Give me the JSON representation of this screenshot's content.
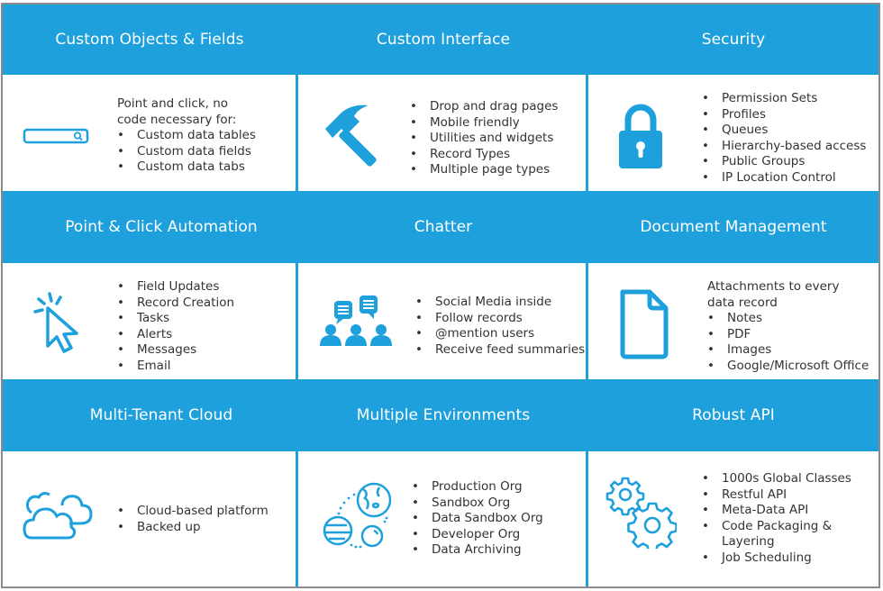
{
  "accent_color": "#1ea0dc",
  "rows": [
    {
      "cells": [
        {
          "title": "Custom Objects & Fields",
          "icon": "search-bar-icon",
          "intro": [
            "Point and click, no",
            "code necessary for:"
          ],
          "items": [
            "Custom data tables",
            "Custom data fields",
            "Custom data tabs"
          ]
        },
        {
          "title": "Custom Interface",
          "icon": "hammer-icon",
          "intro": [],
          "items": [
            "Drop and drag pages",
            "Mobile friendly",
            "Utilities and widgets",
            "Record Types",
            "Multiple page types"
          ]
        },
        {
          "title": "Security",
          "icon": "lock-icon",
          "intro": [],
          "items": [
            "Permission Sets",
            "Profiles",
            "Queues",
            "Hierarchy-based access",
            "Public Groups",
            "IP Location Control"
          ]
        }
      ]
    },
    {
      "cells": [
        {
          "title": "Point & Click Automation",
          "icon": "cursor-click-icon",
          "intro": [],
          "items": [
            "Field Updates",
            "Record Creation",
            "Tasks",
            "Alerts",
            "Messages",
            "Email"
          ]
        },
        {
          "title": "Chatter",
          "icon": "chat-group-icon",
          "intro": [],
          "items": [
            "Social Media inside",
            "Follow records",
            "@mention users",
            "Receive feed summaries"
          ]
        },
        {
          "title": "Document Management",
          "icon": "document-icon",
          "intro": [
            "Attachments to every",
            "data record"
          ],
          "items": [
            "Notes",
            "PDF",
            "Images",
            "Google/Microsoft Office"
          ]
        }
      ]
    },
    {
      "cells": [
        {
          "title": "Multi-Tenant Cloud",
          "icon": "cloud-icon",
          "intro": [],
          "items": [
            "Cloud-based platform",
            "Backed up"
          ]
        },
        {
          "title": "Multiple Environments",
          "icon": "planets-icon",
          "intro": [],
          "items": [
            "Production Org",
            "Sandbox Org",
            "Data Sandbox Org",
            "Developer Org",
            "Data Archiving"
          ]
        },
        {
          "title": "Robust API",
          "icon": "gears-icon",
          "intro": [],
          "items": [
            "1000s Global Classes",
            "Restful API",
            "Meta-Data API",
            "Code Packaging & Layering",
            "Job Scheduling"
          ]
        }
      ]
    }
  ]
}
